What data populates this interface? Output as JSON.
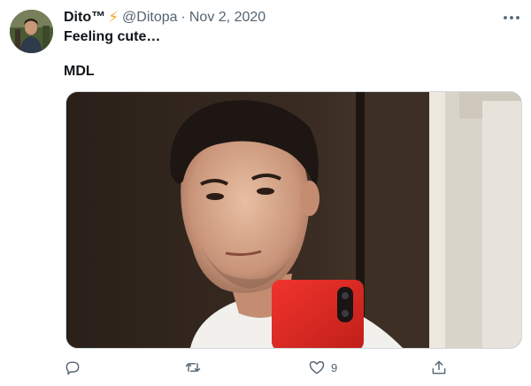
{
  "tweet": {
    "author_name": "Dito™",
    "author_badge": "⚡",
    "handle": "@Ditopa",
    "separator": "·",
    "date": "Nov 2, 2020",
    "text_line1": "Feeling cute…",
    "text_line2": "MDL",
    "more_icon": "more-horizontal-icon",
    "actions": {
      "reply_icon": "reply-icon",
      "retweet_icon": "retweet-icon",
      "like_icon": "heart-icon",
      "like_count": "9",
      "share_icon": "share-icon"
    }
  },
  "colors": {
    "text": "#0f1419",
    "secondary": "#536471",
    "badge": "#f5a623",
    "phone_case": "#e02a24"
  }
}
